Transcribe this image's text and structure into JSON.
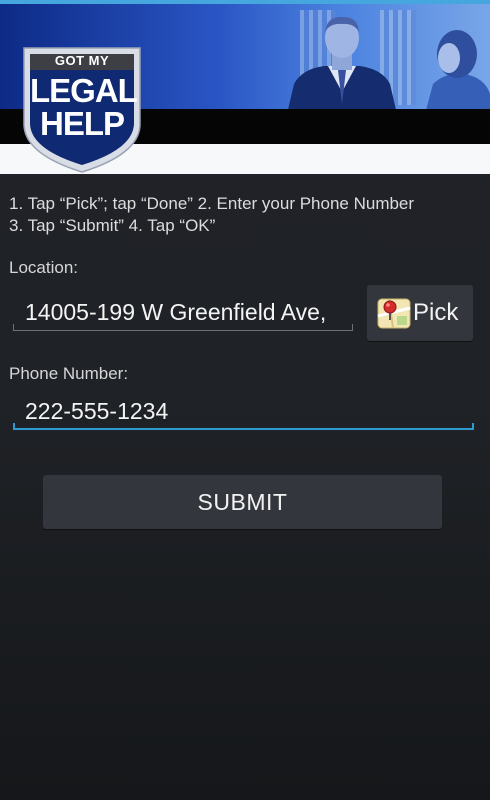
{
  "header": {
    "logo": {
      "top_text": "GOT MY",
      "line1": "LEGAL",
      "line2": "HELP"
    },
    "colors": {
      "banner_blue": "#2a56c5",
      "shield_navy": "#0f2a72",
      "accent_line": "#46a7df"
    }
  },
  "instructions": {
    "line1": "1. Tap “Pick”; tap “Done” 2. Enter your Phone Number",
    "line2": "3. Tap “Submit” 4. Tap “OK”"
  },
  "location": {
    "label": "Location:",
    "value": "14005-199 W Greenfield Ave,",
    "pick_button": {
      "icon": "map-pin-icon",
      "label": "Pick"
    }
  },
  "phone": {
    "label": "Phone Number:",
    "value": "222-555-1234",
    "focus_color": "#2f9ad0"
  },
  "submit": {
    "label": "SUBMIT"
  }
}
